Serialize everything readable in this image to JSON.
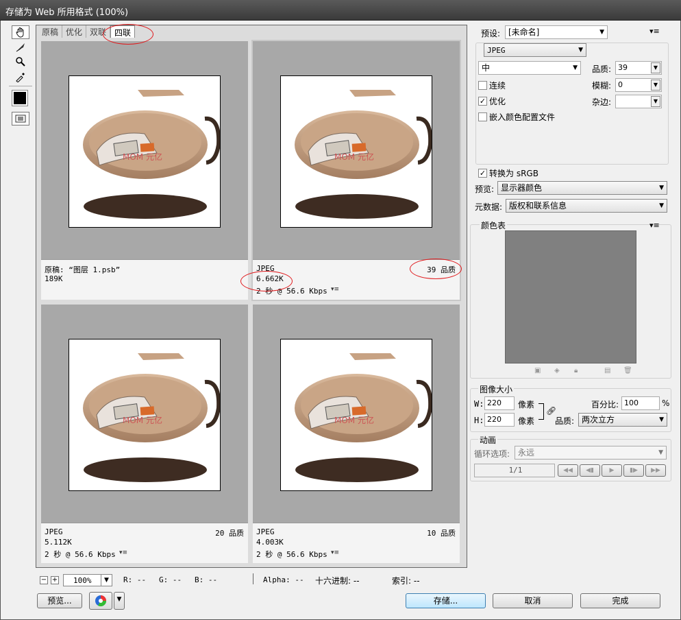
{
  "window": {
    "title": "存储为 Web 所用格式 (100%)"
  },
  "tabs": [
    {
      "label": "原稿"
    },
    {
      "label": "优化"
    },
    {
      "label": "双联"
    },
    {
      "label": "四联"
    }
  ],
  "tools": [
    "hand-tool-icon",
    "slice-select-icon",
    "zoom-icon",
    "eyedropper-icon"
  ],
  "panes": [
    {
      "line1": "原稿: “图层 1.psb”",
      "line2": "189K",
      "line3": "",
      "quality": ""
    },
    {
      "line1": "JPEG",
      "line2": "6.662K",
      "line3": "2 秒 @ 56.6 Kbps",
      "quality": "39 品质"
    },
    {
      "line1": "JPEG",
      "line2": "5.112K",
      "line3": "2 秒 @ 56.6 Kbps",
      "quality": "20 品质"
    },
    {
      "line1": "JPEG",
      "line2": "4.003K",
      "line3": "2 秒 @ 56.6 Kbps",
      "quality": "10 品质"
    }
  ],
  "image_watermark": "MOM 元亿",
  "status": {
    "zoom": "100%",
    "r": "R: --",
    "g": "G: --",
    "b": "B: --",
    "alpha": "Alpha: --",
    "hex": "十六进制: --",
    "index": "索引: --"
  },
  "buttons": {
    "preview": "预览...",
    "save": "存储...",
    "cancel": "取消",
    "done": "完成"
  },
  "settings": {
    "preset_label": "预设:",
    "preset_value": "[未命名]",
    "format": "JPEG",
    "quality_level": "中",
    "quality_label": "品质:",
    "quality_value": "39",
    "progressive_label": "连续",
    "progressive_checked": false,
    "blur_label": "模糊:",
    "blur_value": "0",
    "optimized_label": "优化",
    "optimized_checked": true,
    "matte_label": "杂边:",
    "matte_value": "",
    "embed_profile_label": "嵌入颜色配置文件",
    "embed_profile_checked": false,
    "convert_srgb_label": "转换为 sRGB",
    "convert_srgb_checked": true,
    "preview_label": "预览:",
    "preview_value": "显示器颜色",
    "metadata_label": "元数据:",
    "metadata_value": "版权和联系信息"
  },
  "color_table": {
    "title": "颜色表"
  },
  "image_size": {
    "title": "图像大小",
    "w_label": "W:",
    "w_value": "220",
    "h_label": "H:",
    "h_value": "220",
    "unit": "像素",
    "percent_label": "百分比:",
    "percent_value": "100",
    "percent_unit": "%",
    "quality_label": "品质:",
    "quality_value": "两次立方"
  },
  "animation": {
    "title": "动画",
    "loop_label": "循环选项:",
    "loop_value": "永远",
    "frame_counter": "1/1"
  },
  "colors": {
    "annotation_red": "#e0191c",
    "canvas_gray": "#a8a8a8",
    "palette_gray": "#808080"
  }
}
